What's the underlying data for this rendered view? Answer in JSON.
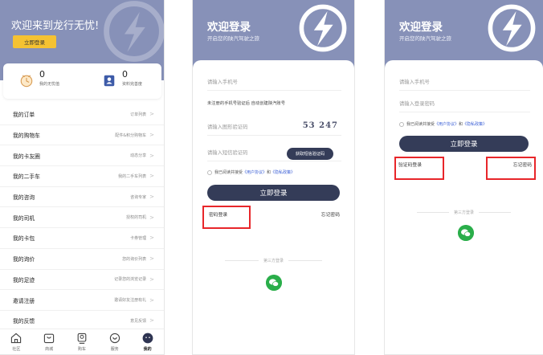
{
  "colors": {
    "hero": "#8791b8",
    "accent_yellow": "#f5c232",
    "button_dark": "#343c58",
    "highlight_red": "#e8262a",
    "wechat_green": "#2aae4a",
    "link_blue": "#3b5fd6"
  },
  "profile": {
    "welcome": "欢迎来到龙行无忧!",
    "login_button": "立即登录",
    "stats": [
      {
        "value": "0",
        "label": "我的无忧值",
        "icon": "clock-icon"
      },
      {
        "value": "0",
        "label": "资料完善度",
        "icon": "profile-card-icon"
      }
    ],
    "menu": [
      {
        "title": "我的订单",
        "right": "订单列表"
      },
      {
        "title": "我的购物车",
        "right": "配件&积分购物车"
      },
      {
        "title": "我的卡友圈",
        "right": "动态分享"
      },
      {
        "title": "我的二手车",
        "right": "我的二手车列表"
      },
      {
        "title": "我的咨询",
        "right": "咨询专家"
      },
      {
        "title": "我的司机",
        "right": "授权的司机"
      },
      {
        "title": "我的卡包",
        "right": "卡券管理"
      },
      {
        "title": "我的询价",
        "right": "您的询价列表"
      },
      {
        "title": "我的足迹",
        "right": "记录您的浏览记录"
      },
      {
        "title": "邀请注册",
        "right": "邀请好友注册有礼"
      },
      {
        "title": "我的反馈",
        "right": "意见反馈"
      }
    ],
    "tabs": [
      {
        "label": "社区",
        "icon": "home-icon"
      },
      {
        "label": "商城",
        "icon": "shopping-bag-icon"
      },
      {
        "label": "购车",
        "icon": "truck-icon"
      },
      {
        "label": "服务",
        "icon": "service-icon"
      },
      {
        "label": "我的",
        "icon": "user-face-icon"
      }
    ]
  },
  "sms_login": {
    "title": "欢迎登录",
    "subtitle": "开启您的陕汽驾驶之旅",
    "phone_placeholder": "请输入手机号",
    "auto_register_note": "未注册的手机号验证后 自动创建陕汽账号",
    "captcha_placeholder": "请输入图形验证码",
    "captcha_text": "53 247",
    "sms_placeholder": "请输入短信验证码",
    "sms_button": "获取短信验证码",
    "agree_prefix": "我已阅读并接受",
    "user_agreement": "《用户协议》",
    "and": "和",
    "privacy_policy": "《隐私政策》",
    "submit": "立即登录",
    "alt_login": "密码登录",
    "forgot": "忘记密码",
    "third_party": "第三方登录"
  },
  "password_login": {
    "title": "欢迎登录",
    "subtitle": "开启您的陕汽驾驶之旅",
    "phone_placeholder": "请输入手机号",
    "password_placeholder": "请输入登录密码",
    "agree_prefix": "我已阅读并接受",
    "user_agreement": "《用户协议》",
    "and": "和",
    "privacy_policy": "《隐私政策》",
    "submit": "立即登录",
    "alt_login": "验证码登录",
    "forgot": "忘记密码",
    "third_party": "第三方登录"
  }
}
